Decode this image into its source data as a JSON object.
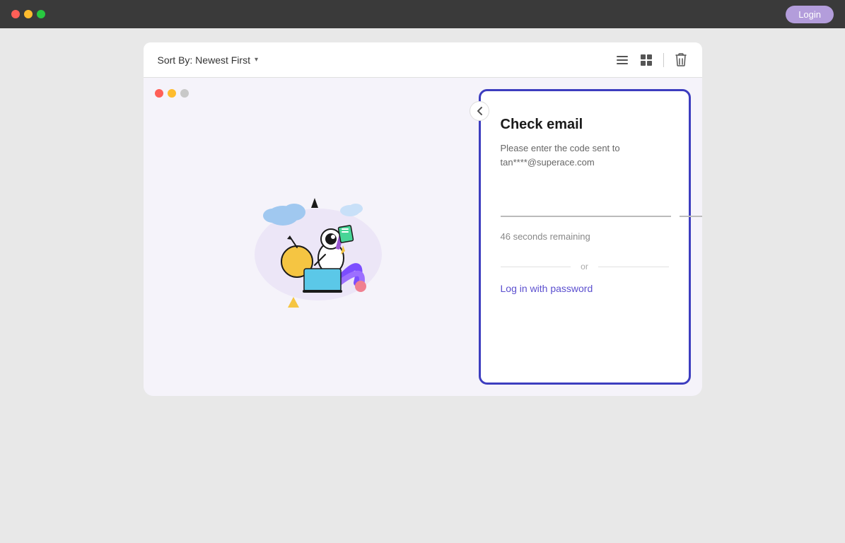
{
  "titleBar": {
    "loginLabel": "Login"
  },
  "toolbar": {
    "sortLabel": "Sort By: Newest First",
    "chevronIcon": "▾",
    "listViewIcon": "list-view",
    "gridViewIcon": "grid-view",
    "deleteIcon": "trash"
  },
  "modal": {
    "trafficLights": [
      "red",
      "yellow",
      "gray"
    ],
    "checkEmail": {
      "title": "Check email",
      "subtitle": "Please enter the code sent to tan****@superace.com",
      "otpFields": [
        "",
        "",
        "",
        ""
      ],
      "timerText": "46 seconds remaining",
      "orText": "or",
      "logInPasswordLabel": "Log in with password"
    }
  }
}
